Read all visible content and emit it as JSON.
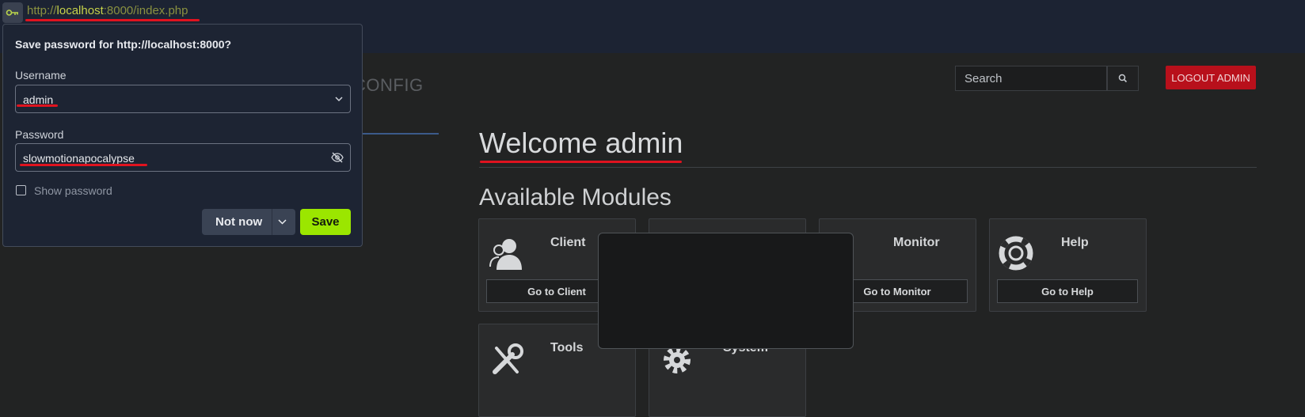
{
  "browser": {
    "url_scheme": "http://",
    "url_host": "localhost",
    "url_rest": ":8000/index.php"
  },
  "save_password_popup": {
    "title": "Save password for http://localhost:8000?",
    "username_label": "Username",
    "username_value": "admin",
    "password_label": "Password",
    "password_value": "slowmotionapocalypse",
    "show_password_label": "Show password",
    "show_password_checked": false,
    "not_now_label": "Not now",
    "save_label": "Save"
  },
  "header": {
    "brand_fragment": "CONFIG",
    "search_placeholder": "Search",
    "logout_label": "LOGOUT ADMIN"
  },
  "main": {
    "welcome": "Welcome admin",
    "modules_heading": "Available Modules",
    "modules": [
      {
        "title": "Client",
        "button": "Go to Client",
        "icon": "client-icon"
      },
      {
        "title": "Monitor",
        "button": "Go to Monitor",
        "icon": "monitor-icon"
      },
      {
        "title": "Help",
        "button": "Go to Help",
        "icon": "lifebuoy-icon"
      },
      {
        "title": "Tools",
        "icon": "tools-icon"
      },
      {
        "title": "System",
        "icon": "gear-icon"
      }
    ]
  },
  "colors": {
    "logout_bg": "#b8101b",
    "save_bg": "#9be600",
    "annotation_red": "#e0131f"
  }
}
